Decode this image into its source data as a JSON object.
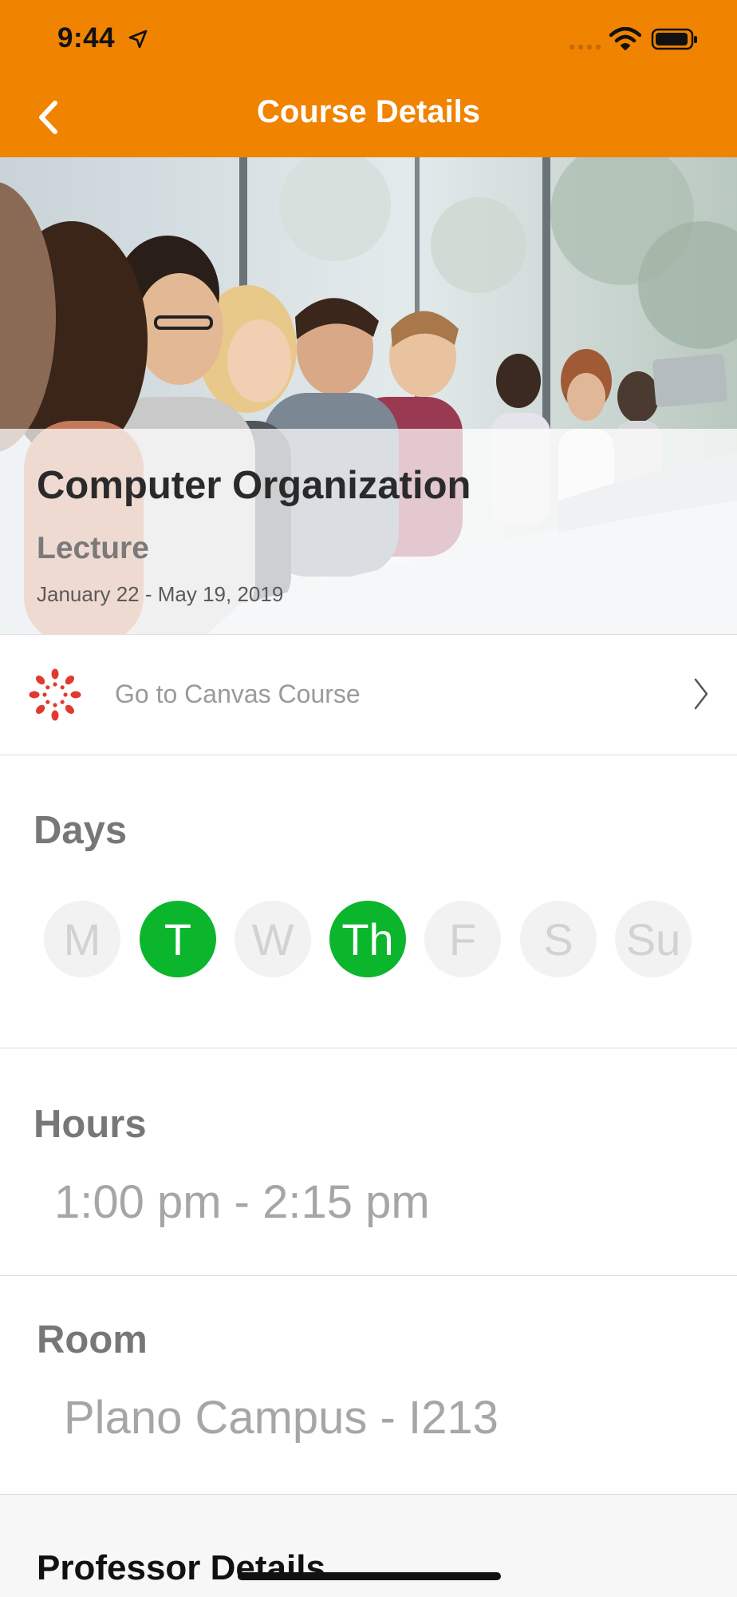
{
  "status_bar": {
    "time": "9:44",
    "icons": [
      "location-arrow-icon",
      "cellular-signal-icon",
      "wifi-icon",
      "battery-icon"
    ]
  },
  "nav": {
    "title": "Course Details",
    "back_icon": "chevron-left-icon"
  },
  "course": {
    "title": "Computer Organization",
    "type": "Lecture",
    "dates": "January 22 - May 19, 2019"
  },
  "canvas_link": {
    "label": "Go to Canvas Course",
    "icon": "canvas-logo-icon"
  },
  "days": {
    "heading": "Days",
    "items": [
      {
        "label": "M",
        "active": false
      },
      {
        "label": "T",
        "active": true
      },
      {
        "label": "W",
        "active": false
      },
      {
        "label": "Th",
        "active": true
      },
      {
        "label": "F",
        "active": false
      },
      {
        "label": "S",
        "active": false
      },
      {
        "label": "Su",
        "active": false
      }
    ]
  },
  "hours": {
    "heading": "Hours",
    "value": "1:00 pm - 2:15 pm"
  },
  "room": {
    "heading": "Room",
    "value": "Plano Campus - I213"
  },
  "professor": {
    "heading": "Professor Details"
  },
  "colors": {
    "header": "#F08300",
    "active_day": "#0BB62C",
    "canvas_red": "#E03A2E"
  }
}
